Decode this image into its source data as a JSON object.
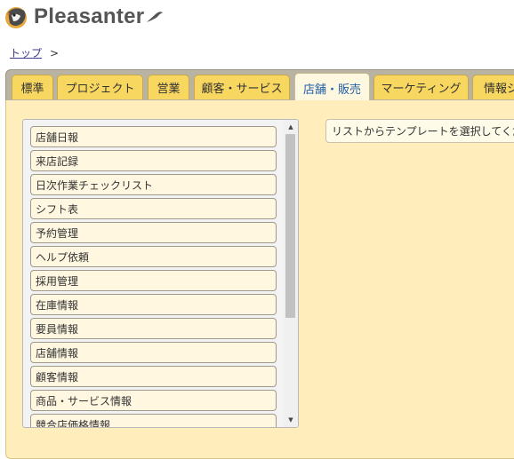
{
  "app": {
    "name": "Pleasanter"
  },
  "breadcrumb": {
    "home": "トップ",
    "separator": ">"
  },
  "tabs": [
    {
      "label": "標準",
      "active": false
    },
    {
      "label": "プロジェクト",
      "active": false
    },
    {
      "label": "営業",
      "active": false
    },
    {
      "label": "顧客・サービス",
      "active": false
    },
    {
      "label": "店舗・販売",
      "active": true
    },
    {
      "label": "マーケティング",
      "active": false
    },
    {
      "label": "情報シ",
      "active": false
    }
  ],
  "templates": [
    "店舗日報",
    "来店記録",
    "日次作業チェックリスト",
    "シフト表",
    "予約管理",
    "ヘルプ依頼",
    "採用管理",
    "在庫情報",
    "要員情報",
    "店舗情報",
    "顧客情報",
    "商品・サービス情報",
    "競合店価格情報"
  ],
  "hint": "リストからテンプレートを選択してくだ",
  "colors": {
    "tab": "#f8d760",
    "panel": "#ffeebc",
    "active_tab_text": "#1f5fa8"
  },
  "icons": {
    "logo": "pleasanter-bird-icon",
    "scroll_up": "triangle-up-icon",
    "scroll_down": "triangle-down-icon"
  }
}
